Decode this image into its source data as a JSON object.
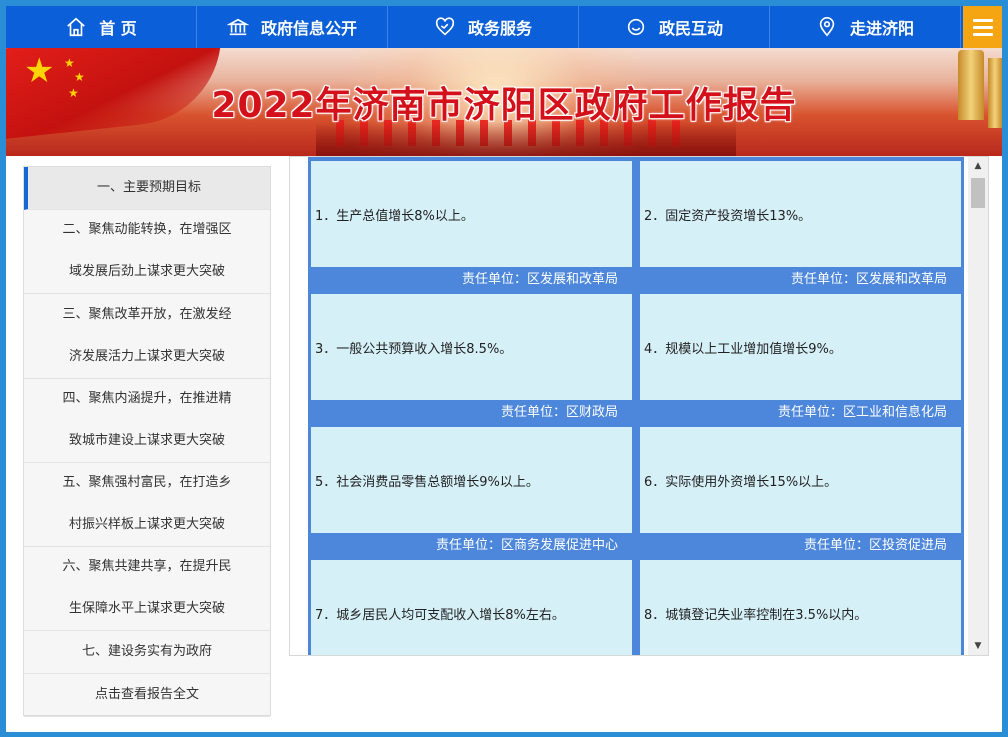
{
  "nav": {
    "items": [
      {
        "label": "首 页",
        "icon": "home-icon"
      },
      {
        "label": "政府信息公开",
        "icon": "government-building-icon"
      },
      {
        "label": "政务服务",
        "icon": "handshake-heart-icon"
      },
      {
        "label": "政民互动",
        "icon": "people-interaction-icon"
      },
      {
        "label": "走进济阳",
        "icon": "location-pin-icon"
      }
    ],
    "menu_icon": "hamburger-menu-icon"
  },
  "banner": {
    "title": "2022年济南市济阳区政府工作报告"
  },
  "sidebar": {
    "items": [
      {
        "lines": [
          "一、主要预期目标"
        ],
        "active": true
      },
      {
        "lines": [
          "二、聚焦动能转换，在增强区",
          "域发展后劲上谋求更大突破"
        ]
      },
      {
        "lines": [
          "三、聚焦改革开放，在激发经",
          "济发展活力上谋求更大突破"
        ]
      },
      {
        "lines": [
          "四、聚焦内涵提升，在推进精",
          "致城市建设上谋求更大突破"
        ]
      },
      {
        "lines": [
          "五、聚焦强村富民，在打造乡",
          "村振兴样板上谋求更大突破"
        ]
      },
      {
        "lines": [
          "六、聚焦共建共享，在提升民",
          "生保障水平上谋求更大突破"
        ]
      },
      {
        "lines": [
          "七、建设务实有为政府"
        ]
      },
      {
        "lines": [
          "点击查看报告全文"
        ]
      }
    ]
  },
  "targets": [
    {
      "text": "1．生产总值增长8%以上。",
      "unit": "责任单位：区发展和改革局"
    },
    {
      "text": "2．固定资产投资增长13%。",
      "unit": "责任单位：区发展和改革局"
    },
    {
      "text": "3．一般公共预算收入增长8.5%。",
      "unit": "责任单位：区财政局"
    },
    {
      "text": "4．规模以上工业增加值增长9%。",
      "unit": "责任单位：区工业和信息化局"
    },
    {
      "text": "5．社会消费品零售总额增长9%以上。",
      "unit": "责任单位：区商务发展促进中心"
    },
    {
      "text": "6．实际使用外资增长15%以上。",
      "unit": "责任单位：区投资促进局"
    },
    {
      "text": "7．城乡居民人均可支配收入增长8%左右。",
      "unit": ""
    },
    {
      "text": "8．城镇登记失业率控制在3.5%以内。",
      "unit": ""
    }
  ],
  "colors": {
    "nav_bg": "#0b5fd8",
    "menu_bg": "#f5a412",
    "cell_bg": "#d6f0f8",
    "grid_bg": "#4d87dc",
    "title_red": "#d4101a"
  }
}
